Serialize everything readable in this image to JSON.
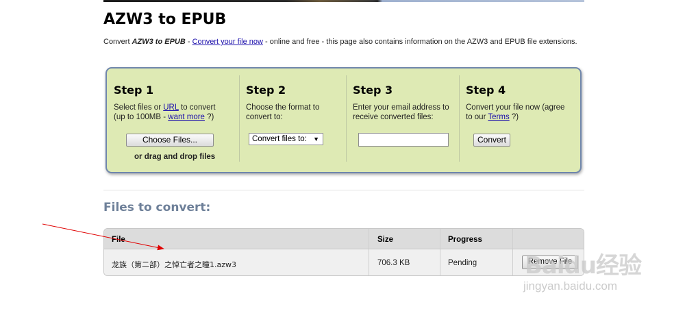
{
  "page": {
    "title": "AZW3 to EPUB",
    "intro": {
      "prefix": "Convert ",
      "emphasis": "AZW3 to EPUB",
      "dash": " - ",
      "link": "Convert your file now",
      "suffix": " - online and free - this page also contains information on the AZW3 and EPUB file extensions."
    }
  },
  "steps": [
    {
      "title": "Step 1",
      "line1_prefix": "Select files or ",
      "line1_link": "URL",
      "line1_suffix": " to convert",
      "line2_prefix": "(up to 100MB - ",
      "line2_link": "want more",
      "line2_suffix": " ?)",
      "button": "Choose Files...",
      "extra": "or drag and drop files"
    },
    {
      "title": "Step 2",
      "line1": "Choose the format to",
      "line2": "convert to:",
      "select": "Convert files to:",
      "select_arrow": "▼"
    },
    {
      "title": "Step 3",
      "line1": "Enter your email address to",
      "line2": "receive converted files:",
      "input_value": ""
    },
    {
      "title": "Step 4",
      "line1": "Convert your file now (agree",
      "line2_prefix": "to our ",
      "line2_link": "Terms",
      "line2_suffix": " ?)",
      "button": "Convert"
    }
  ],
  "files": {
    "title": "Files to convert:",
    "columns": [
      "File",
      "Size",
      "Progress",
      ""
    ],
    "rows": [
      {
        "file": "龙族（第二部）之悼亡者之瞳1.azw3",
        "size": "706.3 KB",
        "progress": "Pending",
        "action": "Remove File"
      }
    ]
  },
  "watermark": {
    "logo": "Baidu经验",
    "url": "jingyan.baidu.com"
  },
  "colors": {
    "steps_bg": "#deeab4",
    "steps_border": "#6f86ac",
    "section_title": "#6e8099",
    "link": "#1a0dab",
    "annotation_arrow": "#e00000"
  }
}
